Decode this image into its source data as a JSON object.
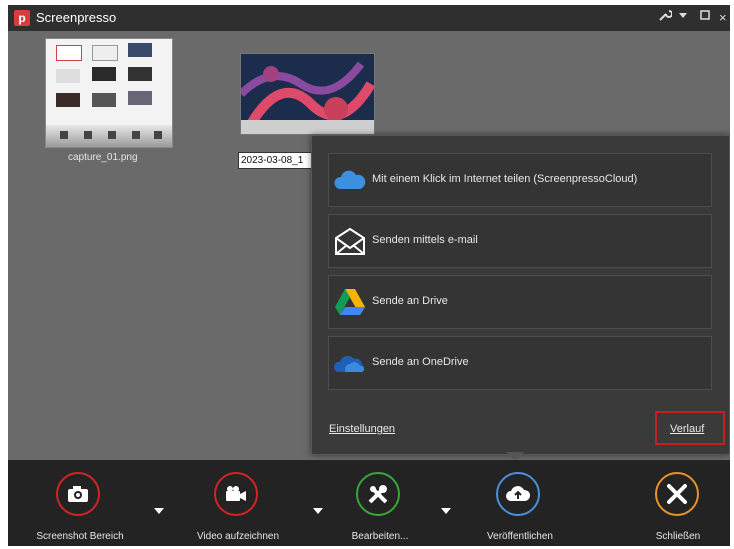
{
  "window": {
    "title": "Screenpresso",
    "app_icon_letter": "p"
  },
  "titlebar_controls": {
    "tools": "tools-icon",
    "menu": "dropdown-icon",
    "maximize": "maximize-icon",
    "close": "×"
  },
  "files": [
    {
      "name": "capture_01.png"
    },
    {
      "name": "2023-03-08_1"
    }
  ],
  "share_menu": {
    "options": [
      {
        "label": "Mit einem Klick im Internet teilen (ScreenpressoCloud)",
        "icon": "cloud-icon"
      },
      {
        "label": "Senden mittels e-mail",
        "icon": "envelope-icon"
      },
      {
        "label": "Sende an Drive",
        "icon": "google-drive-icon"
      },
      {
        "label": "Sende an OneDrive",
        "icon": "onedrive-icon"
      }
    ],
    "settings_link": "Einstellungen",
    "history_link": "Verlauf"
  },
  "toolbar": {
    "buttons": [
      {
        "label": "Screenshot Bereich",
        "icon": "camera-icon",
        "color": "#d32424"
      },
      {
        "label": "Video aufzeichnen",
        "icon": "video-camera-icon",
        "color": "#d32424"
      },
      {
        "label": "Bearbeiten...",
        "icon": "tools-icon",
        "color": "#3aa63a"
      },
      {
        "label": "Veröffentlichen",
        "icon": "cloud-upload-icon",
        "color": "#4a90d9"
      },
      {
        "label": "Schließen",
        "icon": "close-icon",
        "color": "#e8922a"
      }
    ]
  }
}
